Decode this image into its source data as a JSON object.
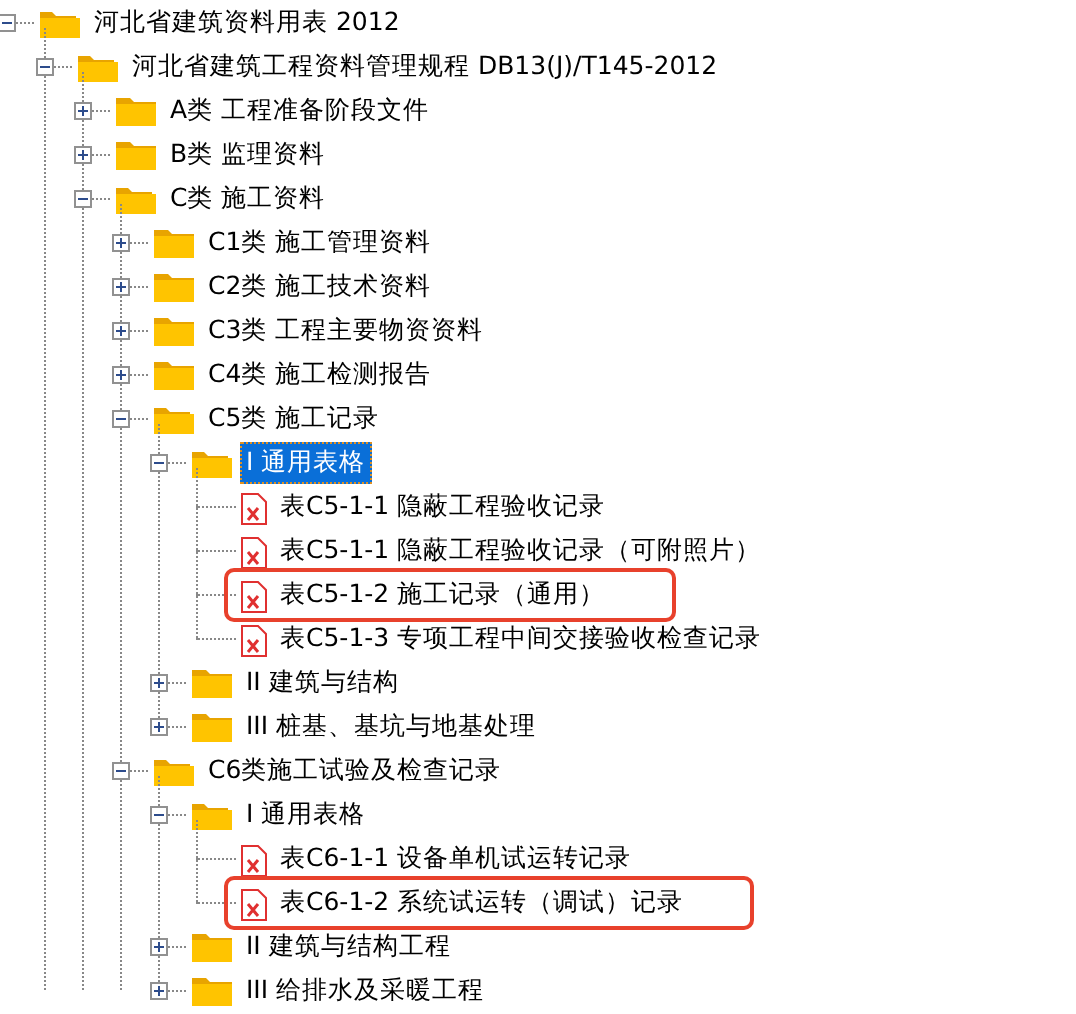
{
  "tree": [
    {
      "kind": "folder",
      "label": "河北省建筑资料用表 2012",
      "expanded": true,
      "selected": false,
      "highlighted": false,
      "children": [
        {
          "kind": "folder",
          "label": "河北省建筑工程资料管理规程 DB13(J)/T145-2012",
          "expanded": true,
          "selected": false,
          "highlighted": false,
          "children": [
            {
              "kind": "folder",
              "label": "A类 工程准备阶段文件",
              "expanded": false,
              "selected": false,
              "highlighted": false
            },
            {
              "kind": "folder",
              "label": "B类 监理资料",
              "expanded": false,
              "selected": false,
              "highlighted": false
            },
            {
              "kind": "folder",
              "label": "C类 施工资料",
              "expanded": true,
              "selected": false,
              "highlighted": false,
              "children": [
                {
                  "kind": "folder",
                  "label": "C1类 施工管理资料",
                  "expanded": false,
                  "selected": false,
                  "highlighted": false
                },
                {
                  "kind": "folder",
                  "label": "C2类 施工技术资料",
                  "expanded": false,
                  "selected": false,
                  "highlighted": false
                },
                {
                  "kind": "folder",
                  "label": "C3类 工程主要物资资料",
                  "expanded": false,
                  "selected": false,
                  "highlighted": false
                },
                {
                  "kind": "folder",
                  "label": "C4类 施工检测报告",
                  "expanded": false,
                  "selected": false,
                  "highlighted": false
                },
                {
                  "kind": "folder",
                  "label": "C5类 施工记录",
                  "expanded": true,
                  "selected": false,
                  "highlighted": false,
                  "children": [
                    {
                      "kind": "folder",
                      "label": "I 通用表格",
                      "expanded": true,
                      "selected": true,
                      "highlighted": false,
                      "children": [
                        {
                          "kind": "document",
                          "label": "表C5-1-1 隐蔽工程验收记录",
                          "selected": false,
                          "highlighted": false
                        },
                        {
                          "kind": "document",
                          "label": "表C5-1-1 隐蔽工程验收记录（可附照片）",
                          "selected": false,
                          "highlighted": false
                        },
                        {
                          "kind": "document",
                          "label": "表C5-1-2 施工记录（通用）",
                          "selected": false,
                          "highlighted": true
                        },
                        {
                          "kind": "document",
                          "label": "表C5-1-3 专项工程中间交接验收检查记录",
                          "selected": false,
                          "highlighted": false
                        }
                      ]
                    },
                    {
                      "kind": "folder",
                      "label": "II 建筑与结构",
                      "expanded": false,
                      "selected": false,
                      "highlighted": false
                    },
                    {
                      "kind": "folder",
                      "label": "III 桩基、基坑与地基处理",
                      "expanded": false,
                      "selected": false,
                      "highlighted": false
                    }
                  ]
                },
                {
                  "kind": "folder",
                  "label": "C6类施工试验及检查记录",
                  "expanded": true,
                  "selected": false,
                  "highlighted": false,
                  "children": [
                    {
                      "kind": "folder",
                      "label": "I 通用表格",
                      "expanded": true,
                      "selected": false,
                      "highlighted": false,
                      "children": [
                        {
                          "kind": "document",
                          "label": "表C6-1-1 设备单机试运转记录",
                          "selected": false,
                          "highlighted": false
                        },
                        {
                          "kind": "document",
                          "label": "表C6-1-2 系统试运转（调试）记录",
                          "selected": false,
                          "highlighted": true
                        }
                      ]
                    },
                    {
                      "kind": "folder",
                      "label": "II 建筑与结构工程",
                      "expanded": false,
                      "selected": false,
                      "highlighted": false
                    },
                    {
                      "kind": "folder",
                      "label": "III 给排水及采暖工程",
                      "expanded": false,
                      "selected": false,
                      "highlighted": false
                    }
                  ]
                }
              ]
            }
          ]
        }
      ]
    }
  ]
}
